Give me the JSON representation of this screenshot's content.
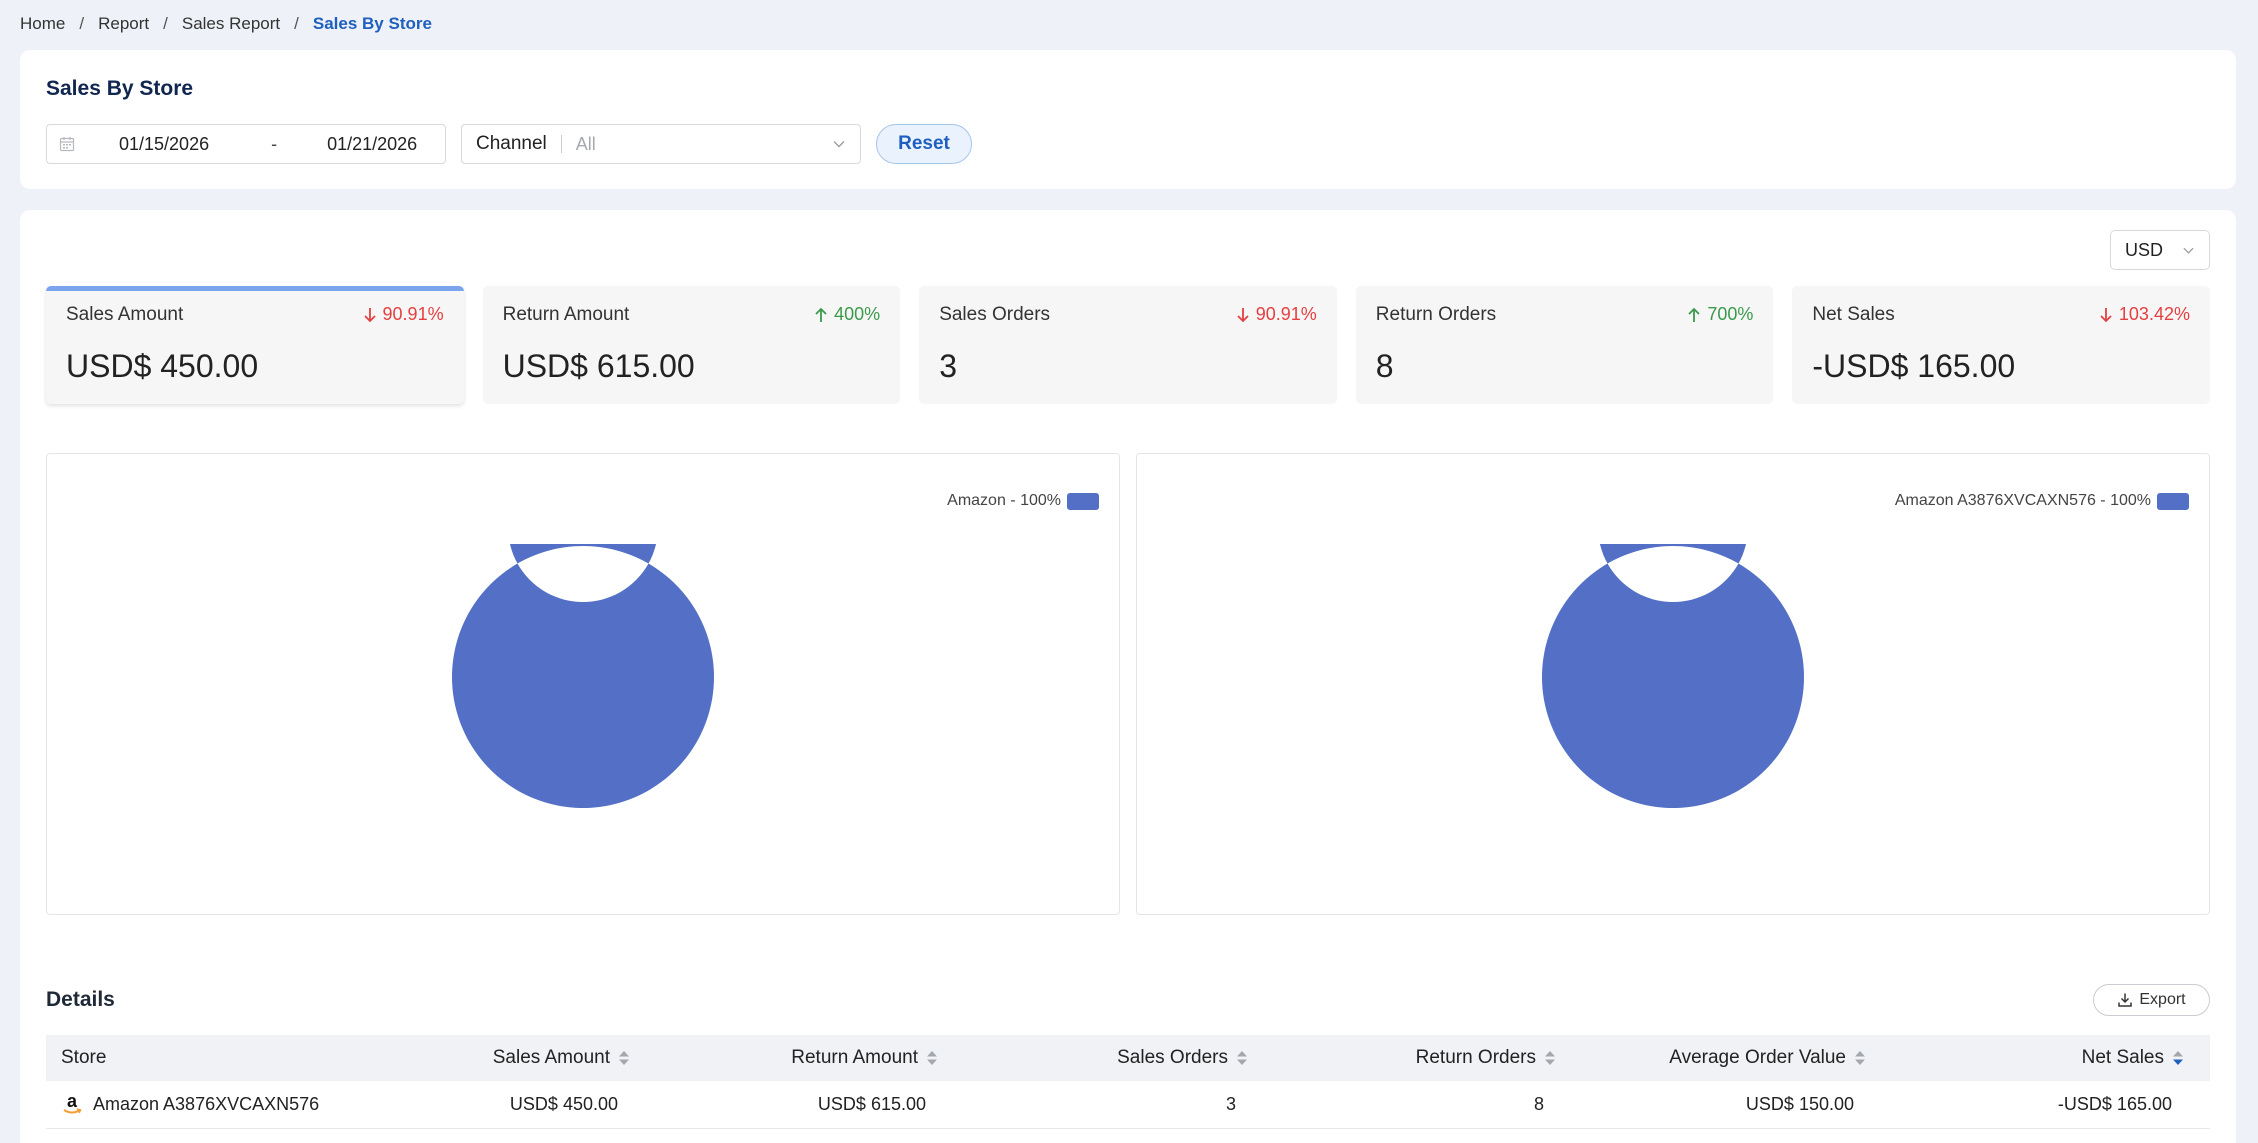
{
  "breadcrumb": {
    "items": [
      "Home",
      "Report",
      "Sales Report"
    ],
    "current": "Sales By Store",
    "separator": "/"
  },
  "filters": {
    "title": "Sales By Store",
    "date_start": "01/15/2026",
    "date_sep": "-",
    "date_end": "01/21/2026",
    "channel_label": "Channel",
    "channel_value": "All",
    "reset_label": "Reset"
  },
  "currency": {
    "value": "USD"
  },
  "metrics": [
    {
      "label": "Sales Amount",
      "change": "90.91%",
      "direction": "down",
      "value": "USD$ 450.00"
    },
    {
      "label": "Return Amount",
      "change": "400%",
      "direction": "up",
      "value": "USD$ 615.00"
    },
    {
      "label": "Sales Orders",
      "change": "90.91%",
      "direction": "down",
      "value": "3"
    },
    {
      "label": "Return Orders",
      "change": "700%",
      "direction": "up",
      "value": "8"
    },
    {
      "label": "Net Sales",
      "change": "103.42%",
      "direction": "down",
      "value": "-USD$ 165.00"
    }
  ],
  "colors": {
    "accent": "#1f5fbf",
    "donut": "#5470c6",
    "down": "#e54040",
    "up": "#3b9a4a"
  },
  "chart_data": [
    {
      "type": "pie",
      "variant": "donut",
      "legend_position": "top-right",
      "series": [
        {
          "name": "Amazon - 100%",
          "values": [
            100
          ]
        }
      ],
      "categories": [
        "Amazon"
      ]
    },
    {
      "type": "pie",
      "variant": "donut",
      "legend_position": "top-right",
      "series": [
        {
          "name": "Amazon A3876XVCAXN576 - 100%",
          "values": [
            100
          ]
        }
      ],
      "categories": [
        "Amazon A3876XVCAXN576"
      ]
    }
  ],
  "details": {
    "title": "Details",
    "export_label": "Export",
    "columns": [
      "Store",
      "Sales Amount",
      "Return Amount",
      "Sales Orders",
      "Return Orders",
      "Average Order Value",
      "Net Sales"
    ],
    "rows": [
      {
        "store": "Amazon A3876XVCAXN576",
        "sales_amount": "USD$ 450.00",
        "return_amount": "USD$ 615.00",
        "sales_orders": "3",
        "return_orders": "8",
        "aov": "USD$ 150.00",
        "net_sales": "-USD$ 165.00"
      }
    ]
  }
}
